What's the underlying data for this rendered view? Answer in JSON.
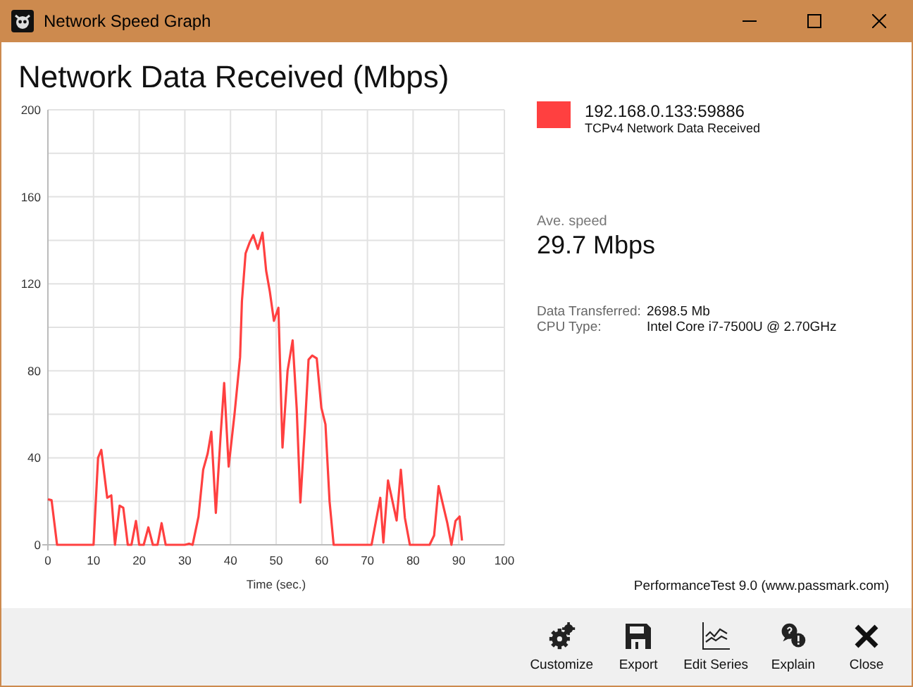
{
  "window": {
    "title": "Network Speed Graph"
  },
  "heading": "Network Data Received (Mbps)",
  "chart_data": {
    "type": "line",
    "xlabel": "Time (sec.)",
    "xlim": [
      0,
      100
    ],
    "ylim": [
      0,
      200
    ],
    "xticks": [
      0,
      10,
      20,
      30,
      40,
      50,
      60,
      70,
      80,
      90,
      100
    ],
    "yticks": [
      0,
      40,
      80,
      120,
      160,
      200
    ],
    "grid": true,
    "x": [
      0,
      0.8,
      2,
      10,
      11,
      11.7,
      13,
      13.9,
      14.7,
      15.7,
      16.5,
      17.5,
      18.3,
      19.3,
      20,
      21,
      22,
      23,
      24,
      24.9,
      25.8,
      30,
      31,
      31.7,
      33,
      34,
      35,
      35.8,
      36.8,
      37.8,
      38.6,
      39.6,
      40.9,
      42.1,
      42.5,
      43.3,
      44.2,
      45,
      46,
      47,
      47.8,
      48.6,
      49.5,
      50.5,
      51.4,
      52.5,
      53.6,
      54.5,
      55.3,
      56.3,
      57.1,
      57.9,
      58.9,
      59.9,
      60.8,
      61.7,
      62.6,
      70.9,
      72.8,
      73.5,
      74.5,
      76.4,
      77.3,
      78.2,
      79.3,
      83.6,
      84.6,
      85.6,
      87.5,
      88.4,
      89.3,
      90.2,
      90.7
    ],
    "series": [
      {
        "name": "192.168.0.133:59886",
        "color": "#ff4040",
        "values": [
          21,
          20.5,
          0,
          0,
          40,
          43.6,
          21.6,
          22.7,
          0,
          18,
          17,
          0,
          0,
          11,
          0,
          0,
          8,
          0,
          0,
          10,
          0,
          0,
          0.5,
          0,
          13,
          34.5,
          42,
          52,
          14.7,
          49.6,
          74.4,
          36,
          60.4,
          86.3,
          112,
          134,
          139,
          142.4,
          136,
          143.5,
          126,
          116.5,
          103,
          109,
          44.7,
          80,
          94,
          62.6,
          19.4,
          54,
          85.2,
          87,
          85.7,
          63,
          55.4,
          20,
          0,
          0,
          21.6,
          1,
          29.6,
          11.2,
          34.5,
          12.3,
          0,
          0,
          4.3,
          27,
          10,
          0,
          11,
          13,
          2
        ]
      }
    ]
  },
  "legend": {
    "sublabel": "TCPv4 Network Data Received"
  },
  "speed": {
    "label": "Ave. speed",
    "value": "29.7 Mbps"
  },
  "info": [
    {
      "label": "Data Transferred:",
      "value": "2698.5 Mb"
    },
    {
      "label": "CPU Type:",
      "value": "Intel Core i7-7500U @ 2.70GHz"
    }
  ],
  "credit": "PerformanceTest 9.0 (www.passmark.com)",
  "toolbar": [
    {
      "kind": "customize",
      "label": "Customize"
    },
    {
      "kind": "export",
      "label": "Export"
    },
    {
      "kind": "edit",
      "label": "Edit Series"
    },
    {
      "kind": "explain",
      "label": "Explain"
    },
    {
      "kind": "close",
      "label": "Close"
    }
  ]
}
